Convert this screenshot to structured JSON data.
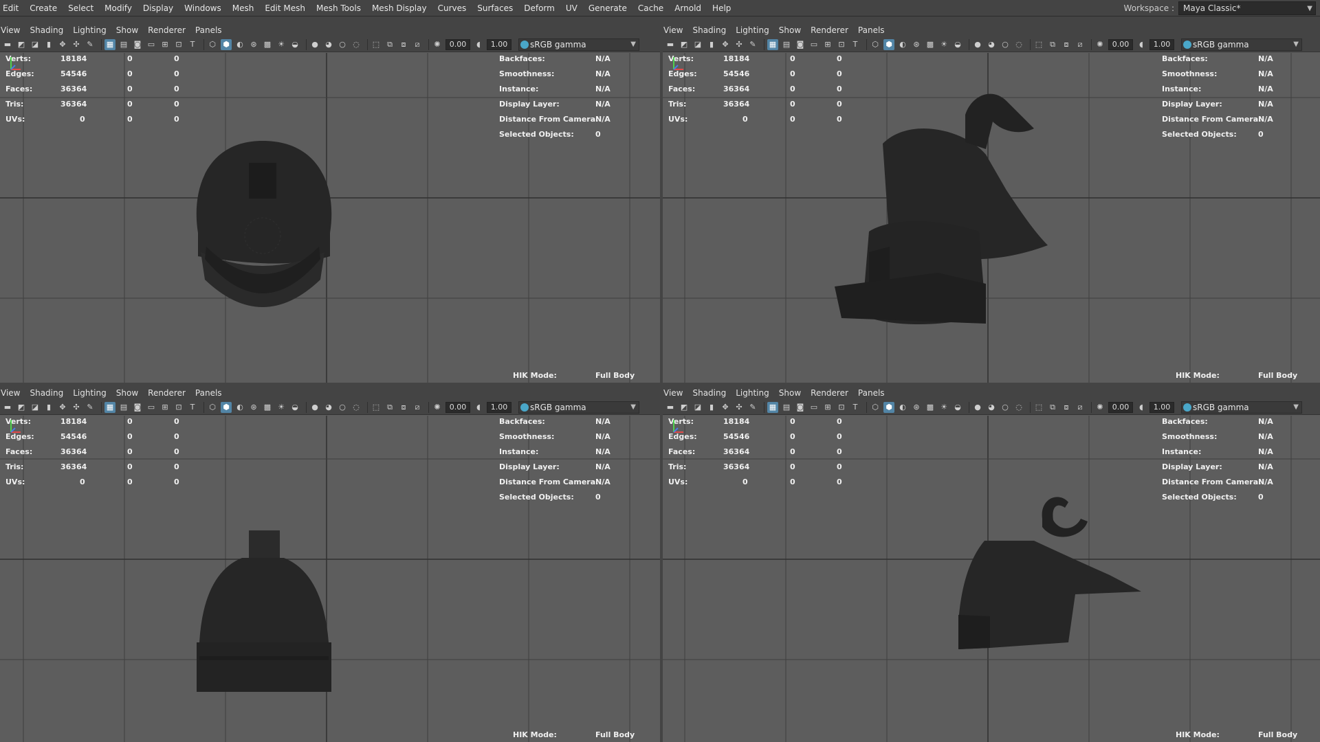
{
  "menubar": {
    "items": [
      "Edit",
      "Create",
      "Select",
      "Modify",
      "Display",
      "Windows",
      "Mesh",
      "Edit Mesh",
      "Mesh Tools",
      "Mesh Display",
      "Curves",
      "Surfaces",
      "Deform",
      "UV",
      "Generate",
      "Cache",
      "Arnold",
      "Help"
    ],
    "workspace_label": "Workspace :",
    "workspace_value": "Maya Classic*"
  },
  "panel_menu": [
    "View",
    "Shading",
    "Lighting",
    "Show",
    "Renderer",
    "Panels"
  ],
  "toolbar": {
    "exposure": "0.00",
    "gamma": "1.00",
    "color_space": "sRGB gamma"
  },
  "hud": {
    "left_rows": [
      {
        "label": "Verts:",
        "v1": "18184",
        "v2": "0",
        "v3": "0"
      },
      {
        "label": "Edges:",
        "v1": "54546",
        "v2": "0",
        "v3": "0"
      },
      {
        "label": "Faces:",
        "v1": "36364",
        "v2": "0",
        "v3": "0"
      },
      {
        "label": "Tris:",
        "v1": "36364",
        "v2": "0",
        "v3": "0"
      },
      {
        "label": "UVs:",
        "v1": "0",
        "v2": "0",
        "v3": "0"
      }
    ],
    "right_rows": [
      {
        "label": "Backfaces:",
        "value": "N/A"
      },
      {
        "label": "Smoothness:",
        "value": "N/A"
      },
      {
        "label": "Instance:",
        "value": "N/A"
      },
      {
        "label": "Display Layer:",
        "value": "N/A"
      },
      {
        "label": "Distance From Camera:",
        "value": "N/A"
      },
      {
        "label": "Selected Objects:",
        "value": "0"
      }
    ],
    "hik_label": "HIK Mode:",
    "hik_value": "Full Body"
  },
  "panels": [
    {
      "id": "top-left",
      "view": "front"
    },
    {
      "id": "top-right",
      "view": "perspective"
    },
    {
      "id": "bottom-left",
      "view": "front-lower"
    },
    {
      "id": "bottom-right",
      "view": "side"
    }
  ],
  "colors": {
    "viewport_bg": "#5d5d5d",
    "menu_bg": "#444444",
    "grid_line": "#3f3f3f",
    "mesh": "#262626",
    "active_icon": "#5285a6"
  }
}
